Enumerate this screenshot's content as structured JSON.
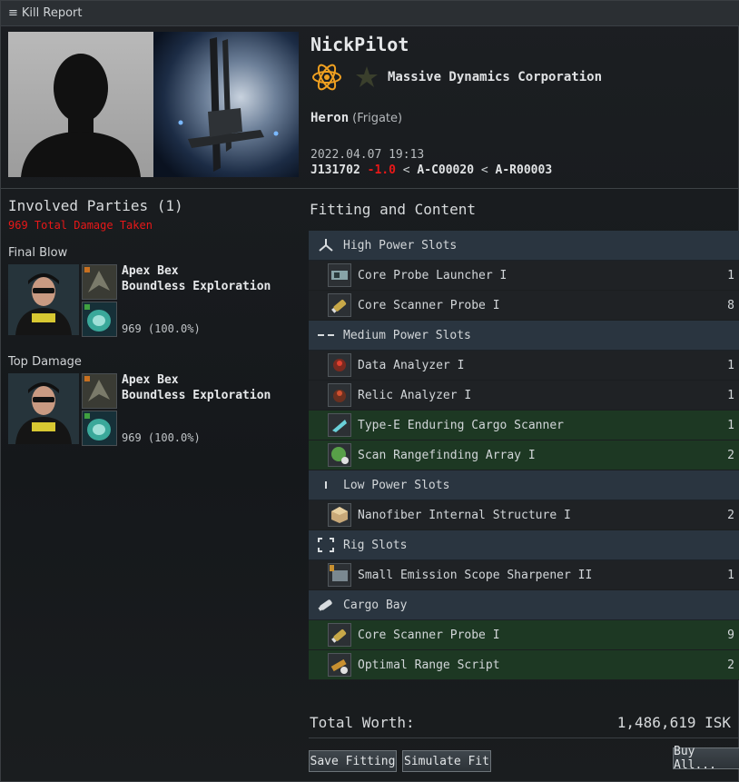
{
  "window": {
    "title": "Kill Report",
    "menu_icon": "hamburger-icon"
  },
  "victim": {
    "name": "NickPilot",
    "corporation": "Massive Dynamics Corporation",
    "ship": "Heron",
    "ship_class": "(Frigate)",
    "datetime": "2022.04.07 19:13",
    "system": "J131702",
    "security": "-1.0",
    "sep1": "<",
    "constellation": "A-C00020",
    "sep2": "<",
    "region": "A-R00003"
  },
  "involved": {
    "title": "Involved Parties  (1)",
    "damage_total": "969 Total Damage Taken",
    "final_blow": {
      "label": "Final Blow",
      "name": "Apex Bex",
      "corp": "Boundless Exploration",
      "damage": "969 (100.0%)"
    },
    "top_damage": {
      "label": "Top Damage",
      "name": "Apex Bex",
      "corp": "Boundless Exploration",
      "damage": "969 (100.0%)"
    }
  },
  "fitting": {
    "title": "Fitting and Content",
    "sections": [
      {
        "label": "High Power Slots",
        "icon": "high-slot-icon",
        "items": [
          {
            "name": "Core Probe Launcher I",
            "qty": "1",
            "dropped": false,
            "icon": "probe-launcher-icon"
          },
          {
            "name": "Core Scanner Probe I",
            "qty": "8",
            "dropped": false,
            "icon": "scanner-probe-icon"
          }
        ]
      },
      {
        "label": "Medium Power Slots",
        "icon": "mid-slot-icon",
        "items": [
          {
            "name": "Data Analyzer I",
            "qty": "1",
            "dropped": false,
            "icon": "data-analyzer-icon"
          },
          {
            "name": "Relic Analyzer I",
            "qty": "1",
            "dropped": false,
            "icon": "relic-analyzer-icon"
          },
          {
            "name": "Type-E Enduring Cargo Scanner",
            "qty": "1",
            "dropped": true,
            "icon": "cargo-scanner-icon"
          },
          {
            "name": "Scan Rangefinding Array I",
            "qty": "2",
            "dropped": true,
            "icon": "rangefinding-array-icon"
          }
        ]
      },
      {
        "label": "Low Power Slots",
        "icon": "low-slot-icon",
        "items": [
          {
            "name": "Nanofiber Internal Structure I",
            "qty": "2",
            "dropped": false,
            "icon": "nanofiber-icon"
          }
        ]
      },
      {
        "label": "Rig Slots",
        "icon": "rig-slot-icon",
        "items": [
          {
            "name": "Small Emission Scope Sharpener II",
            "qty": "1",
            "dropped": false,
            "icon": "scope-sharpener-icon"
          }
        ]
      },
      {
        "label": "Cargo Bay",
        "icon": "cargo-bay-icon",
        "items": [
          {
            "name": "Core Scanner Probe I",
            "qty": "9",
            "dropped": true,
            "icon": "scanner-probe-icon"
          },
          {
            "name": "Optimal Range Script",
            "qty": "2",
            "dropped": true,
            "icon": "range-script-icon"
          }
        ]
      }
    ]
  },
  "total": {
    "label": "Total Worth:",
    "value": "1,486,619 ISK"
  },
  "buttons": {
    "save": "Save Fitting",
    "simulate": "Simulate Fit",
    "buy": "Buy All..."
  },
  "colors": {
    "dropped_row": "#1d3823",
    "section_row": "#2a3540",
    "security_red": "#e81818"
  }
}
